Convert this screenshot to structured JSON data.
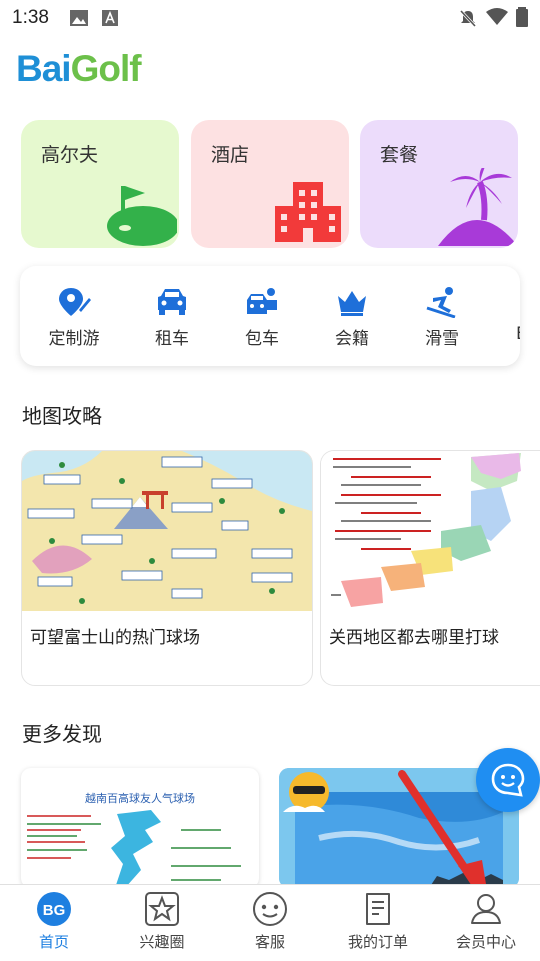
{
  "status_bar": {
    "time": "1:38"
  },
  "brand": {
    "logo_text": "BaiGolf",
    "logo_part1": "Bai",
    "logo_part2": "Golf"
  },
  "categories": [
    {
      "label": "高尔夫",
      "icon": "golf-flag-icon",
      "bg": "#e6f9cf"
    },
    {
      "label": "酒店",
      "icon": "hotel-building-icon",
      "bg": "#fde1e2"
    },
    {
      "label": "套餐",
      "icon": "palm-tree-icon",
      "bg": "#ecdcfb"
    }
  ],
  "services": [
    {
      "label": "定制游",
      "icon": "custom-tour-icon"
    },
    {
      "label": "租车",
      "icon": "car-rental-icon"
    },
    {
      "label": "包车",
      "icon": "chartered-car-icon"
    },
    {
      "label": "会籍",
      "icon": "crown-icon"
    },
    {
      "label": "滑雪",
      "icon": "ski-icon"
    },
    {
      "label": "B",
      "icon": "more-icon"
    }
  ],
  "map_section": {
    "title": "地图攻略",
    "cards": [
      {
        "caption": "可望富士山的热门球场"
      },
      {
        "caption": "关西地区都去哪里打球"
      }
    ]
  },
  "discover_section": {
    "title": "更多发现",
    "cards": [
      {
        "heading": "越南百高球友人气球场"
      }
    ]
  },
  "bottom_nav": [
    {
      "label": "首页",
      "icon": "bg-home-icon",
      "active": true
    },
    {
      "label": "兴趣圈",
      "icon": "star-icon",
      "active": false
    },
    {
      "label": "客服",
      "icon": "chat-face-icon",
      "active": false
    },
    {
      "label": "我的订单",
      "icon": "order-icon",
      "active": false
    },
    {
      "label": "会员中心",
      "icon": "member-icon",
      "active": false
    }
  ],
  "colors": {
    "accent": "#1e7fe0",
    "logo_blue": "#1e8fd6",
    "logo_green": "#6cc04a",
    "hotel_red": "#f23a3a",
    "golf_green": "#33b14a",
    "palm_purple": "#a83ad8"
  }
}
